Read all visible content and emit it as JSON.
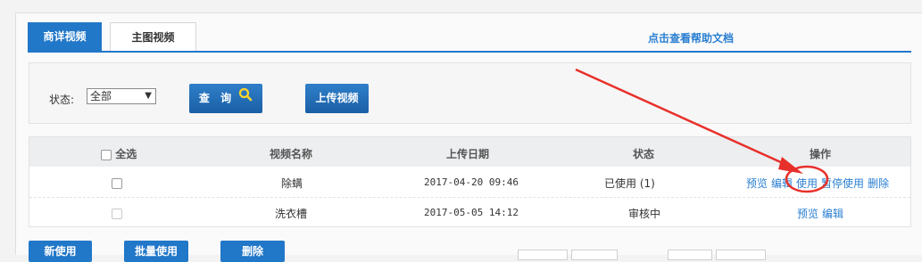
{
  "tabs": [
    {
      "label": "商详视频",
      "active": true
    },
    {
      "label": "主图视频",
      "active": false
    }
  ],
  "help_link": "点击查看帮助文档",
  "filter": {
    "status_label": "状态:",
    "status_value": "全部",
    "query_button": "查 询",
    "upload_button": "上传视频"
  },
  "table": {
    "headers": {
      "select_all": "全选",
      "name": "视频名称",
      "date": "上传日期",
      "status": "状态",
      "actions": "操作"
    },
    "rows": [
      {
        "name": "除螨",
        "date": "2017-04-20 09:46",
        "status": "已使用 (1)",
        "actions": [
          "预览",
          "编辑",
          "使用",
          "暂停使用",
          "删除"
        ]
      },
      {
        "name": "洗衣槽",
        "date": "2017-05-05 14:12",
        "status": "审核中",
        "actions": [
          "预览",
          "编辑"
        ]
      }
    ]
  },
  "bottom_buttons": [
    "新使用",
    "批量使用",
    "删除"
  ],
  "colors": {
    "accent": "#2177c8",
    "link": "#2a7fd2",
    "annotation": "#e8302a"
  }
}
